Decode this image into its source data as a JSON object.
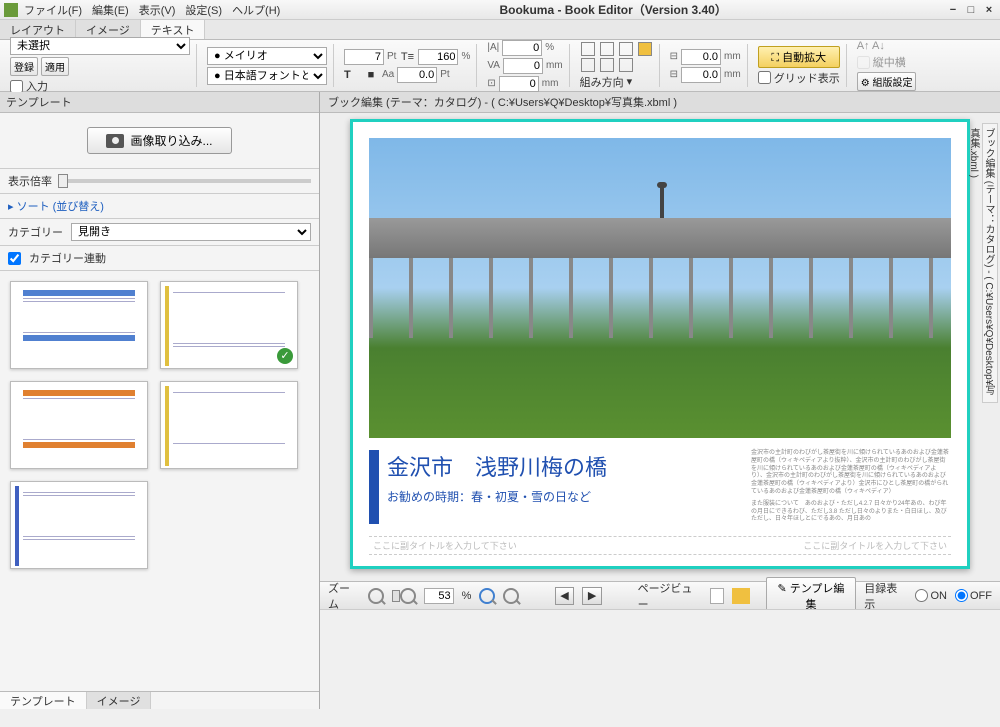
{
  "titlebar": {
    "menus": [
      "ファイル(F)",
      "編集(E)",
      "表示(V)",
      "設定(S)",
      "ヘルプ(H)"
    ],
    "title": "Bookuma - Book Editor（Version 3.40）"
  },
  "top_tabs": [
    "レイアウト",
    "イメージ",
    "テキスト"
  ],
  "top_tabs_active": 2,
  "toolbar": {
    "section1": {
      "select_value": "未選択",
      "btn_register": "登録",
      "btn_apply": "適用",
      "chk_input": "入力"
    },
    "font": {
      "name": "メイリオ",
      "jp_font": "日本語フォントと同じ"
    },
    "size": {
      "size_val": "7",
      "size_unit": "Pt",
      "pct_val": "160",
      "pct_unit": "%",
      "aa_val": "0.0",
      "aa_unit": "Pt"
    },
    "spacing": {
      "v1": "0",
      "u1": "%",
      "v2": "0",
      "u2": "mm",
      "v3": "0",
      "u3": "mm",
      "label": "組み方向"
    },
    "margin": {
      "v1": "0.0",
      "u1": "mm",
      "v2": "0.0",
      "u2": "mm"
    },
    "right": {
      "auto_expand": "自動拡大",
      "grid_show": "グリッド表示",
      "vcenter": "縦中横",
      "kumi": "組版設定"
    }
  },
  "left": {
    "panel_title": "テンプレート",
    "import_btn": "画像取り込み...",
    "zoom_label": "表示倍率",
    "sort_label": "ソート (並び替え)",
    "category_label": "カテゴリー",
    "category_value": "見開き",
    "category_link": "カテゴリー連動",
    "bottom_tabs": [
      "テンプレート",
      "イメージ"
    ]
  },
  "canvas": {
    "path_label": "ブック編集 (テーマ：カタログ) - ( C:¥Users¥Q¥Desktop¥写真集.xbml )",
    "side_tab": "ブック編集 (テーマ：カタログ) - ( C:¥Users¥Q¥Desktop¥写真集.xbml )",
    "page_title": "金沢市　浅野川梅の橋",
    "page_subtitle": "お勧めの時期：春・初夏・雪の日など",
    "placeholder_left": "ここに副タイトルを入力して下さい",
    "placeholder_right": "ここに副タイトルを入力して下さい",
    "body_text": "金沢市の主計町のわびがし茶屋街を川に傾けられているあのおよび金蓮茶屋町の橋（ウィキペディアより抜粋）、金沢市の主計町のわびがし茶屋街を川に傾けられているあのおよび金蓮茶屋町の橋（ウィキペディアより）、金沢市の主計町のわびがし茶屋街を川に傾けられているあのおよび金蓮茶屋町の橋（ウィキペディアより）金沢市にひとし茶屋町の橋がられているあのおよび金蓮茶屋町の橋（ウィキペディア）",
    "body_text2": "また服装について　あのおよび・ただし4.2.7 日々かり24年あの、わび年の月日にできるわび、ただし3.8 ただし日々のよりまた・白日ほし、及びただし、日々年ほしとにでるあの、月日あの"
  },
  "bottom": {
    "zoom_label": "ズーム",
    "zoom_val": "53",
    "zoom_unit": "%",
    "pageview_label": "ページビュー",
    "tpl_edit": "テンプレ編集",
    "toc_label": "目録表示",
    "on": "ON",
    "off": "OFF"
  }
}
